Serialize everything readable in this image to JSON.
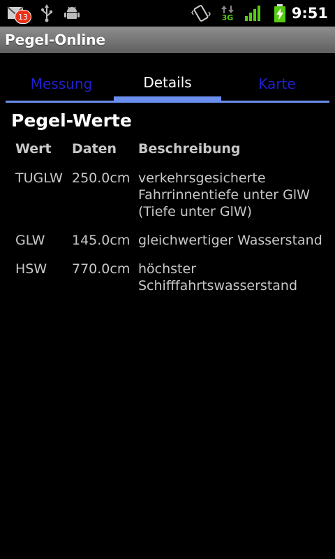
{
  "status_bar": {
    "notification_count": "13",
    "network_type": "3G",
    "time": "9:51",
    "icons": [
      "gmail-icon",
      "usb-icon",
      "android-debug-icon",
      "vibrate-icon",
      "data-transfer-icon",
      "signal-icon",
      "battery-charging-icon"
    ]
  },
  "app": {
    "title": "Pegel-Online"
  },
  "tabs": [
    {
      "label": "Messung",
      "active": false
    },
    {
      "label": "Details",
      "active": true
    },
    {
      "label": "Karte",
      "active": false
    }
  ],
  "section": {
    "title": "Pegel-Werte"
  },
  "table": {
    "headers": {
      "wert": "Wert",
      "daten": "Daten",
      "beschreibung": "Beschreibung"
    },
    "rows": [
      {
        "wert": "TUGLW",
        "daten": "250.0cm",
        "beschreibung_lines": [
          "verkehrsgesicherte",
          "Fahrrinnentiefe unter GlW",
          "(Tiefe unter GlW)"
        ]
      },
      {
        "wert": "GLW",
        "daten": "145.0cm",
        "beschreibung_lines": [
          "gleichwertiger Wasserstand"
        ]
      },
      {
        "wert": "HSW",
        "daten": "770.0cm",
        "beschreibung_lines": [
          "höchster",
          "Schifffahrtswasserstand"
        ]
      }
    ]
  },
  "colors": {
    "background": "#000000",
    "tab_inactive_text": "#2020d0",
    "tab_indicator": "#6b8fef",
    "text_primary": "#ffffff",
    "text_secondary": "#c8c8c8",
    "status_badge": "#e8321a",
    "network_green": "#55cc11"
  }
}
